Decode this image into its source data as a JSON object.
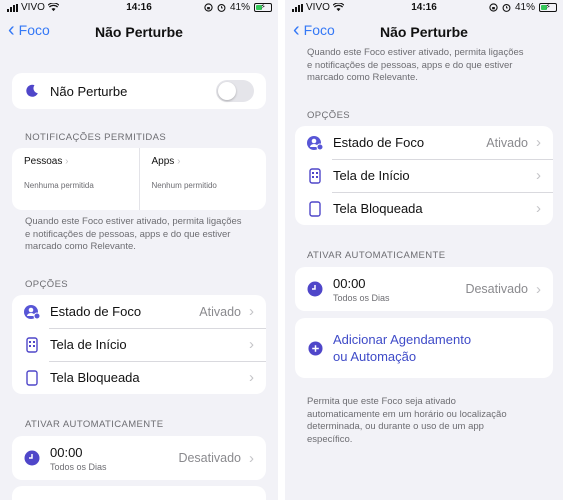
{
  "status": {
    "carrier": "VIVO",
    "time": "14:16",
    "battery": "41%",
    "battery_level": 0.41
  },
  "nav": {
    "back_label": "Foco",
    "title": "Não Perturbe"
  },
  "left": {
    "toggle": {
      "label": "Não Perturbe",
      "on": false
    },
    "notifications": {
      "title": "NOTIFICAÇÕES PERMITIDAS",
      "people": {
        "label": "Pessoas",
        "sub": "Nenhuma permitida"
      },
      "apps": {
        "label": "Apps",
        "sub": "Nenhum permitido"
      },
      "note_lines": [
        "Quando este Foco estiver ativado, permita ligações",
        "e notificações de pessoas, apps e do que estiver",
        "marcado como Relevante."
      ]
    },
    "options": {
      "title": "OPÇÕES",
      "items": [
        {
          "label": "Estado de Foco",
          "value": "Ativado",
          "icon": "focus-status-icon"
        },
        {
          "label": "Tela de Início",
          "value": "",
          "icon": "home-screen-icon"
        },
        {
          "label": "Tela Bloqueada",
          "value": "",
          "icon": "lock-screen-icon"
        }
      ]
    },
    "auto": {
      "title": "ATIVAR AUTOMATICAMENTE",
      "time": "00:00",
      "days": "Todos os Dias",
      "value": "Desativado"
    }
  },
  "right": {
    "top_note_lines": [
      "Quando este Foco estiver ativado, permita ligações",
      "e notificações de pessoas, apps e do que estiver",
      "marcado como Relevante."
    ],
    "options": {
      "title": "OPÇÕES",
      "items": [
        {
          "label": "Estado de Foco",
          "value": "Ativado",
          "icon": "focus-status-icon"
        },
        {
          "label": "Tela de Início",
          "value": "",
          "icon": "home-screen-icon"
        },
        {
          "label": "Tela Bloqueada",
          "value": "",
          "icon": "lock-screen-icon"
        }
      ]
    },
    "auto": {
      "title": "ATIVAR AUTOMATICAMENTE",
      "time": "00:00",
      "days": "Todos os Dias",
      "value": "Desativado",
      "add_line1": "Adicionar Agendamento",
      "add_line2": "ou Automação",
      "note_lines": [
        "Permita que este Foco seja ativado",
        "automaticamente em um horário ou localização",
        "determinada, ou durante o uso de um app",
        "específico."
      ]
    }
  },
  "colors": {
    "accent": "#3478f6",
    "indigo": "#5856d6",
    "background": "#f2f2f7",
    "battery_green": "#34c759"
  }
}
